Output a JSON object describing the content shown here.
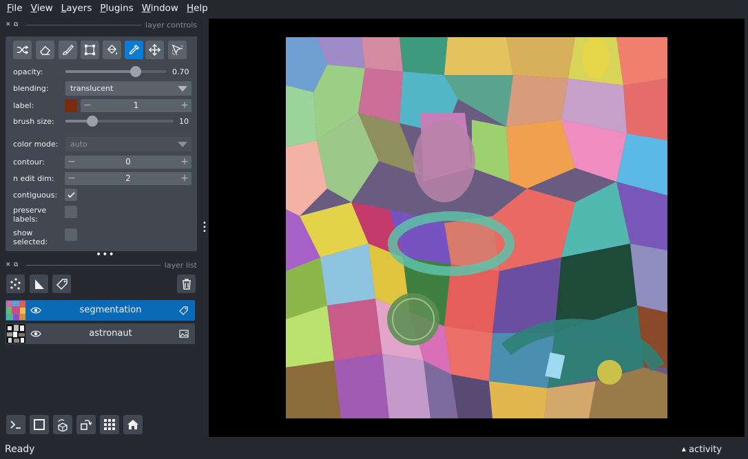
{
  "menu": [
    {
      "label": "File",
      "underline": "F",
      "rest": "ile"
    },
    {
      "label": "View",
      "underline": "V",
      "rest": "iew"
    },
    {
      "label": "Layers",
      "underline": "L",
      "rest": "ayers"
    },
    {
      "label": "Plugins",
      "underline": "P",
      "rest": "lugins"
    },
    {
      "label": "Window",
      "underline": "W",
      "rest": "indow"
    },
    {
      "label": "Help",
      "underline": "H",
      "rest": "elp"
    }
  ],
  "layer_controls": {
    "title": "layer controls",
    "tools": [
      "shuffle-icon",
      "eraser-icon",
      "paintbrush-icon",
      "polygon-icon",
      "fill-bucket-icon",
      "color-picker-icon",
      "pan-zoom-icon",
      "transform-icon"
    ],
    "active_tool": "color-picker-icon",
    "opacity": {
      "label": "opacity:",
      "value": "0.70",
      "fraction": 0.7
    },
    "blending": {
      "label": "blending:",
      "value": "translucent"
    },
    "label": {
      "label": "label:",
      "value": "1",
      "color": "#7a2a0f"
    },
    "brush_size": {
      "label": "brush size:",
      "value": "10",
      "fraction": 0.25
    },
    "color_mode": {
      "label": "color mode:",
      "value": "auto"
    },
    "contour": {
      "label": "contour:",
      "value": "0"
    },
    "n_edit_dim": {
      "label": "n edit dim:",
      "value": "2"
    },
    "contiguous": {
      "label": "contiguous:",
      "checked": true
    },
    "preserve_labels": {
      "label_line1": "preserve",
      "label_line2": "labels:",
      "checked": false
    },
    "show_selected": {
      "label_line1": "show",
      "label_line2": "selected:",
      "checked": false
    }
  },
  "layer_list": {
    "title": "layer list",
    "layers": [
      {
        "name": "segmentation",
        "type": "labels",
        "selected": true,
        "visible": true
      },
      {
        "name": "astronaut",
        "type": "image",
        "selected": false,
        "visible": true
      }
    ]
  },
  "bottom_buttons": [
    "console-icon",
    "2d-3d-toggle-icon",
    "roll-icon",
    "transpose-icon",
    "grid-icon",
    "home-icon"
  ],
  "status": {
    "text": "Ready",
    "activity": "activity"
  },
  "colors": {
    "accent": "#0b7bd6",
    "panel": "#414851",
    "background": "#262930"
  }
}
